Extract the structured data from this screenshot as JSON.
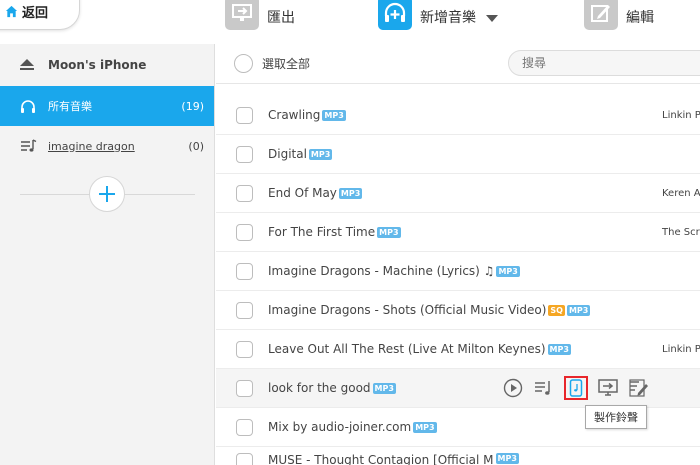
{
  "toolbar": {
    "back_label": "返回",
    "export_label": "匯出",
    "add_music_label": "新增音樂",
    "edit_label": "編輯"
  },
  "sidebar": {
    "device_name": "Moon's iPhone",
    "items": [
      {
        "label": "所有音樂",
        "count": "(19)",
        "icon": "headphones-icon",
        "active": true
      },
      {
        "label": "imagine dragon",
        "count": "(0)",
        "icon": "playlist-icon",
        "active": false
      }
    ]
  },
  "list": {
    "select_all_label": "選取全部",
    "search_placeholder": "搜尋",
    "rows": [
      {
        "title": "Crawling",
        "badges": [
          "MP3"
        ],
        "artist": "Linkin P"
      },
      {
        "title": "Digital",
        "badges": [
          "MP3"
        ],
        "artist": ""
      },
      {
        "title": "End Of May",
        "badges": [
          "MP3"
        ],
        "artist": "Keren A"
      },
      {
        "title": "For The First Time",
        "badges": [
          "MP3"
        ],
        "artist": "The Scri"
      },
      {
        "title": "Imagine Dragons - Machine (Lyrics) ♫",
        "badges": [
          "MP3"
        ],
        "artist": ""
      },
      {
        "title": "Imagine Dragons - Shots (Official Music Video)",
        "badges": [
          "SQ",
          "MP3"
        ],
        "artist": ""
      },
      {
        "title": "Leave Out All The Rest (Live At Milton Keynes)",
        "badges": [
          "MP3"
        ],
        "artist": "Linkin P"
      },
      {
        "title": "look for the good",
        "badges": [
          "MP3"
        ],
        "artist": ""
      },
      {
        "title": "Mix by audio-joiner.com",
        "badges": [
          "MP3"
        ],
        "artist": ""
      },
      {
        "title": "MUSE - Thought Contagion [Official M",
        "badges": [
          "MP3"
        ],
        "artist": ""
      }
    ]
  },
  "tooltip": "製作鈴聲",
  "colors": {
    "accent": "#1aa7ec",
    "highlight_border": "#e8262b",
    "badge": "#62b8ea",
    "badge_sq": "#f5a623"
  }
}
